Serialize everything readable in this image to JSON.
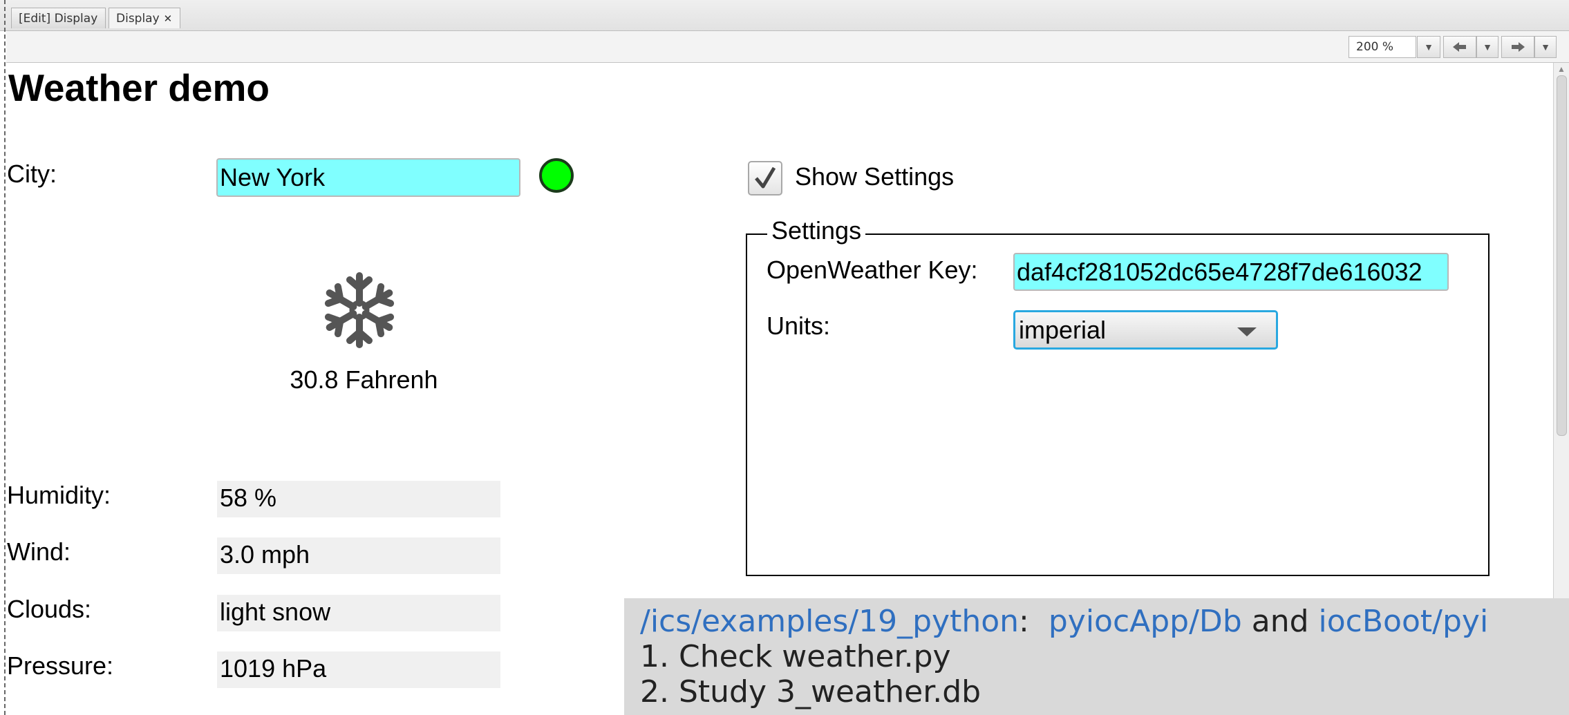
{
  "tabs": [
    {
      "label": "[Edit] Display"
    },
    {
      "label": "Display",
      "close": "✕"
    }
  ],
  "toolbar": {
    "zoom": "200 %",
    "icons": [
      "chevron-down-icon",
      "arrow-left-icon",
      "chevron-down-icon",
      "arrow-right-icon",
      "chevron-down-icon"
    ]
  },
  "display": {
    "title": "Weather demo",
    "city_label": "City:",
    "city_value": "New York",
    "status_color": "#00ff00",
    "weather_icon": "snowflake-icon",
    "temperature": "30.8 Fahrenh",
    "rows": [
      {
        "label": "Humidity:",
        "value": "58 %"
      },
      {
        "label": "Wind:",
        "value": "3.0 mph"
      },
      {
        "label": "Clouds:",
        "value": "light snow"
      },
      {
        "label": "Pressure:",
        "value": "1019 hPa"
      }
    ],
    "show_settings_label": "Show Settings",
    "show_settings_checked": true,
    "settings": {
      "legend": "Settings",
      "key_label": "OpenWeather Key:",
      "key_value": "daf4cf281052dc65e4728f7de616032",
      "units_label": "Units:",
      "units_value": "imperial"
    }
  },
  "note": {
    "path1": "/ics/examples/19_python",
    "colon": ":",
    "path2": "pyiocApp/Db",
    "and": "and",
    "path3": "iocBoot/pyi",
    "items": [
      "1.  Check weather.py",
      "2.  Study 3_weather.db"
    ]
  },
  "colors": {
    "cyan_field": "#80ffff",
    "link_blue": "#2f6fc0",
    "combo_focus": "#29a8e0"
  }
}
